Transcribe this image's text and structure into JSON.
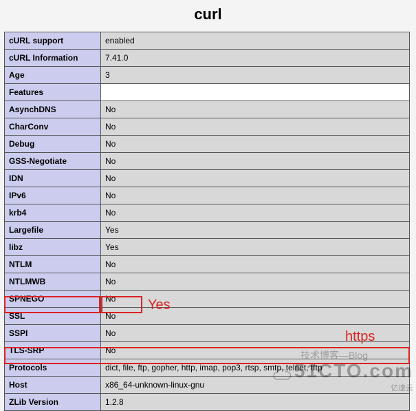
{
  "title": "curl",
  "rows": [
    {
      "label": "cURL support",
      "value": "enabled",
      "cls": ""
    },
    {
      "label": "cURL Information",
      "value": "7.41.0",
      "cls": ""
    },
    {
      "label": "Age",
      "value": "3",
      "cls": ""
    },
    {
      "label": "Features",
      "value": "",
      "cls": "features"
    },
    {
      "label": "AsynchDNS",
      "value": "No",
      "cls": ""
    },
    {
      "label": "CharConv",
      "value": "No",
      "cls": ""
    },
    {
      "label": "Debug",
      "value": "No",
      "cls": ""
    },
    {
      "label": "GSS-Negotiate",
      "value": "No",
      "cls": ""
    },
    {
      "label": "IDN",
      "value": "No",
      "cls": ""
    },
    {
      "label": "IPv6",
      "value": "No",
      "cls": ""
    },
    {
      "label": "krb4",
      "value": "No",
      "cls": ""
    },
    {
      "label": "Largefile",
      "value": "Yes",
      "cls": ""
    },
    {
      "label": "libz",
      "value": "Yes",
      "cls": ""
    },
    {
      "label": "NTLM",
      "value": "No",
      "cls": ""
    },
    {
      "label": "NTLMWB",
      "value": "No",
      "cls": ""
    },
    {
      "label": "SPNEGO",
      "value": "No",
      "cls": ""
    },
    {
      "label": "SSL",
      "value": "No",
      "cls": ""
    },
    {
      "label": "SSPI",
      "value": "No",
      "cls": ""
    },
    {
      "label": "TLS-SRP",
      "value": "No",
      "cls": ""
    },
    {
      "label": "Protocols",
      "value": "dict, file, ftp, gopher, http, imap, pop3, rtsp, smtp, telnet, tftp",
      "cls": ""
    },
    {
      "label": "Host",
      "value": "x86_64-unknown-linux-gnu",
      "cls": ""
    },
    {
      "label": "ZLib Version",
      "value": "1.2.8",
      "cls": ""
    }
  ],
  "annotations": {
    "yes_label": "Yes",
    "https_label": "https"
  },
  "watermark": {
    "cn1": "技术博客—Blog",
    "main": "51CTO.com",
    "sub": "亿速云"
  }
}
